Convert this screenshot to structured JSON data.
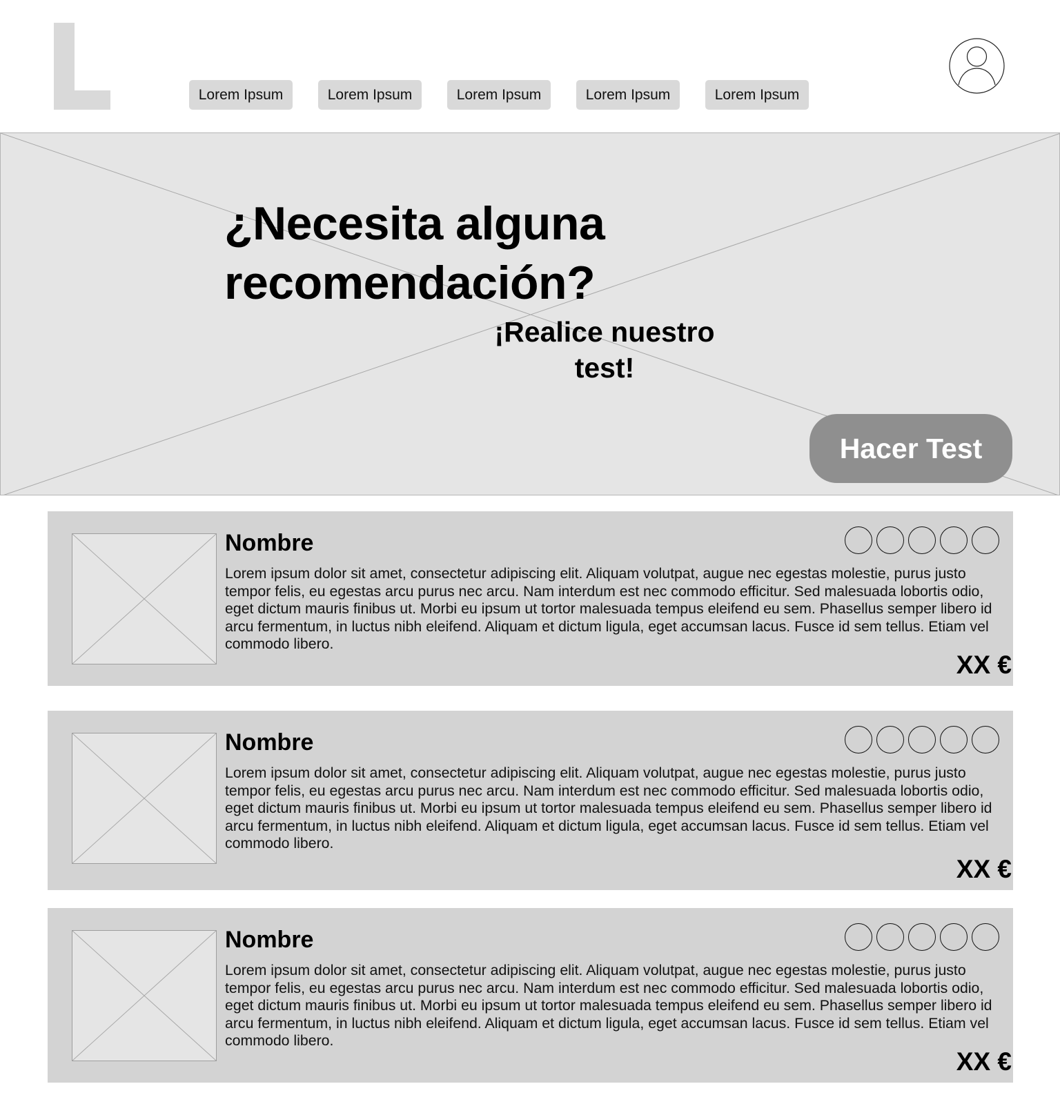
{
  "header": {
    "logo_icon": "logo-l-icon",
    "nav": [
      "Lorem Ipsum",
      "Lorem Ipsum",
      "Lorem Ipsum",
      "Lorem Ipsum",
      "Lorem Ipsum"
    ],
    "avatar_icon": "user-avatar-icon"
  },
  "hero": {
    "title": "¿Necesita alguna recomendación?",
    "subtitle": "¡Realice nuestro test!",
    "button_label": "Hacer Test",
    "image_icon": "image-placeholder-icon"
  },
  "products": [
    {
      "name": "Nombre",
      "rating_max": 5,
      "description": "Lorem ipsum dolor sit amet, consectetur adipiscing elit. Aliquam volutpat, augue nec egestas molestie, purus justo tempor felis, eu egestas arcu purus nec arcu. Nam interdum est nec commodo efficitur. Sed malesuada lobortis odio, eget dictum mauris finibus ut. Morbi eu ipsum ut tortor malesuada tempus eleifend eu sem. Phasellus semper libero id arcu fermentum, in luctus nibh eleifend. Aliquam et dictum ligula, eget accumsan lacus. Fusce id sem tellus. Etiam vel commodo libero.",
      "price": "XX €"
    },
    {
      "name": "Nombre",
      "rating_max": 5,
      "description": "Lorem ipsum dolor sit amet, consectetur adipiscing elit. Aliquam volutpat, augue nec egestas molestie, purus justo tempor felis, eu egestas arcu purus nec arcu. Nam interdum est nec commodo efficitur. Sed malesuada lobortis odio, eget dictum mauris finibus ut. Morbi eu ipsum ut tortor malesuada tempus eleifend eu sem. Phasellus semper libero id arcu fermentum, in luctus nibh eleifend. Aliquam et dictum ligula, eget accumsan lacus. Fusce id sem tellus. Etiam vel commodo libero.",
      "price": "XX €"
    },
    {
      "name": "Nombre",
      "rating_max": 5,
      "description": "Lorem ipsum dolor sit amet, consectetur adipiscing elit. Aliquam volutpat, augue nec egestas molestie, purus justo tempor felis, eu egestas arcu purus nec arcu. Nam interdum est nec commodo efficitur. Sed malesuada lobortis odio, eget dictum mauris finibus ut. Morbi eu ipsum ut tortor malesuada tempus eleifend eu sem. Phasellus semper libero id arcu fermentum, in luctus nibh eleifend. Aliquam et dictum ligula, eget accumsan lacus. Fusce id sem tellus. Etiam vel commodo libero.",
      "price": "XX €"
    }
  ],
  "colors": {
    "placeholder_bg": "#e5e5e5",
    "card_bg": "#d3d3d3",
    "nav_bg": "#d9d9d9",
    "button_bg": "#8f8f8f"
  }
}
